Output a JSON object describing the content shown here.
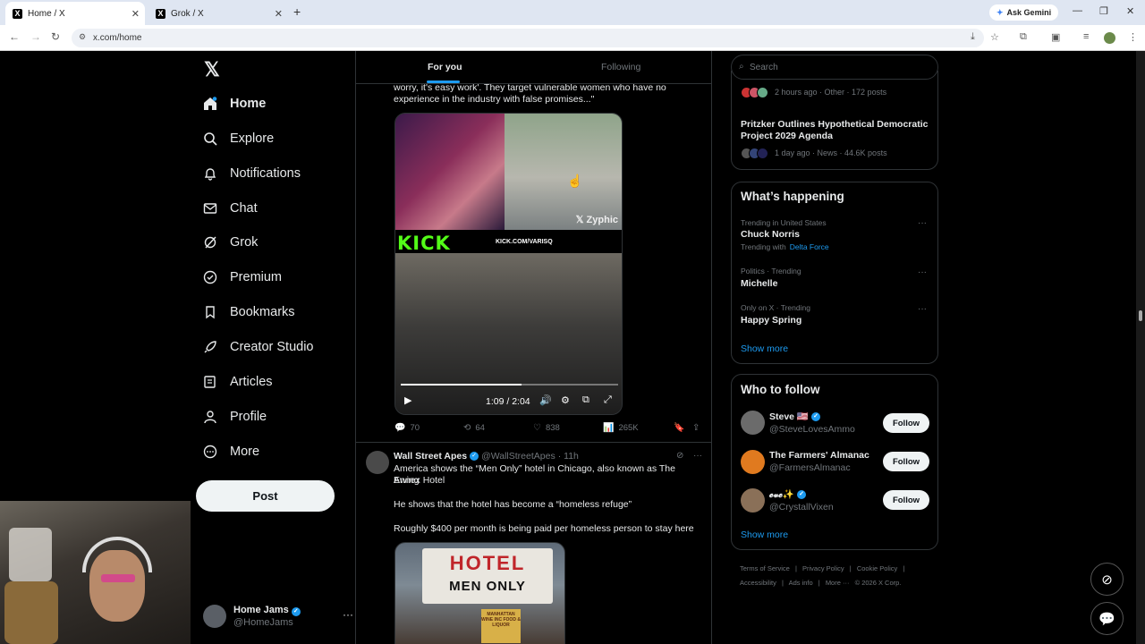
{
  "browser": {
    "tabs": [
      {
        "title": "Home / X",
        "active": true
      },
      {
        "title": "Grok / X",
        "active": false
      }
    ],
    "url": "x.com/home",
    "gemini_label": "Ask Gemini"
  },
  "nav": {
    "items": [
      {
        "label": "Home",
        "icon": "home-icon"
      },
      {
        "label": "Explore",
        "icon": "search-icon"
      },
      {
        "label": "Notifications",
        "icon": "bell-icon"
      },
      {
        "label": "Chat",
        "icon": "mail-icon"
      },
      {
        "label": "Grok",
        "icon": "grok-icon"
      },
      {
        "label": "Premium",
        "icon": "verified-icon"
      },
      {
        "label": "Bookmarks",
        "icon": "bookmark-icon"
      },
      {
        "label": "Creator Studio",
        "icon": "rocket-icon"
      },
      {
        "label": "Articles",
        "icon": "article-icon"
      },
      {
        "label": "Profile",
        "icon": "person-icon"
      },
      {
        "label": "More",
        "icon": "more-circle-icon"
      }
    ],
    "post_label": "Post",
    "account": {
      "name": "Home Jams",
      "handle": "@HomeJams"
    }
  },
  "feed": {
    "tabs": [
      "For you",
      "Following"
    ],
    "post1": {
      "text_line1": "worry, it's easy work'. They target vulnerable women who have no",
      "text_line2": "experience in the industry with false promises...\"",
      "video": {
        "watermark": "Zyphic",
        "kick_logo": "KICK",
        "kick_url": "KICK.COM/VARISQ",
        "time": "1:09 / 2:04",
        "progress": 0.556
      },
      "stats": {
        "replies": "70",
        "reposts": "64",
        "likes": "838",
        "views": "265K"
      }
    },
    "post2": {
      "name": "Wall Street Apes",
      "handle": "@WallStreetApes",
      "time": "· 11h",
      "line1": "America shows the “Men Only” hotel in Chicago, also known as The Ewing",
      "line2": "Annex Hotel",
      "para2": "He shows that the hotel has become a “homeless refuge”",
      "para3": "Roughly $400 per month is being paid per homeless person to stay here",
      "image_sign1": "HOTEL",
      "image_sign2": "MEN ONLY",
      "image_sign3": "MANHATTAN WINE INC FOOD & LIQUOR"
    }
  },
  "sidebar": {
    "search_placeholder": "Search",
    "news": [
      {
        "meta": "2 hours ago · Other · 172 posts"
      },
      {
        "headline": "Pritzker Outlines Hypothetical Democratic Project 2029 Agenda",
        "meta": "1 day ago · News · 44.6K posts"
      }
    ],
    "whats_happening": {
      "title": "What’s happening",
      "trends": [
        {
          "context": "Trending in United States",
          "name": "Chuck Norris",
          "sub": "Trending with",
          "link": "Delta Force"
        },
        {
          "context": "Politics · Trending",
          "name": "Michelle"
        },
        {
          "context": "Only on X · Trending",
          "name": "Happy Spring"
        }
      ],
      "show_more": "Show more"
    },
    "who_to_follow": {
      "title": "Who to follow",
      "accounts": [
        {
          "name": "Steve 🇺🇸",
          "handle": "@SteveLovesAmmo",
          "button": "Follow",
          "color": "#6b6b6b"
        },
        {
          "name": "The Farmers' Almanac",
          "handle": "@FarmersAlmanac",
          "button": "Follow",
          "color": "#e07a1f"
        },
        {
          "name": "𝓮𝓿𝓮✨",
          "handle": "@CrystallVixen",
          "button": "Follow",
          "color": "#8a7058"
        }
      ],
      "show_more": "Show more"
    },
    "footer": [
      "Terms of Service",
      "|",
      "Privacy Policy",
      "|",
      "Cookie Policy",
      "|",
      "Accessibility",
      "|",
      "Ads info",
      "|",
      "More ···",
      "© 2026 X Corp."
    ]
  }
}
